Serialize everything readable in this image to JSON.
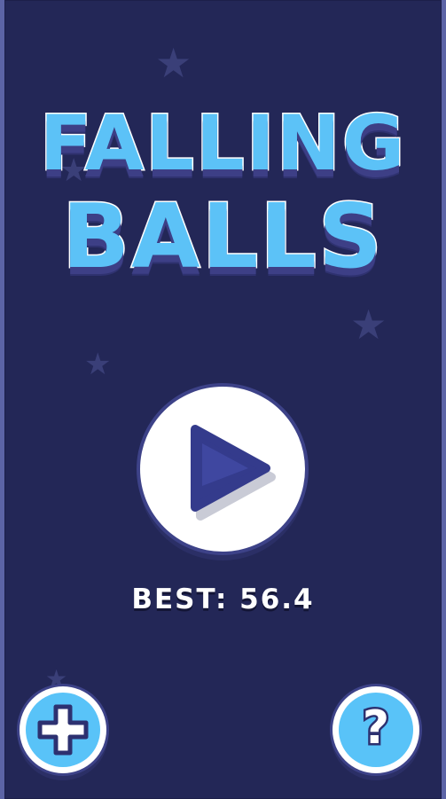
{
  "game": {
    "title_line1": "FALLING",
    "title_line2": "BALLS",
    "best_label": "BEST:",
    "best_value": "56.4"
  },
  "buttons": {
    "play_icon": "play-icon",
    "add_icon": "plus-icon",
    "help_symbol": "?"
  },
  "colors": {
    "background": "#232757",
    "frame": "#5c64a6",
    "title_fill": "#5cc2f7",
    "button_fill": "#59c3f8",
    "play_triangle": "#343b8c",
    "star": "#3a3f78"
  }
}
